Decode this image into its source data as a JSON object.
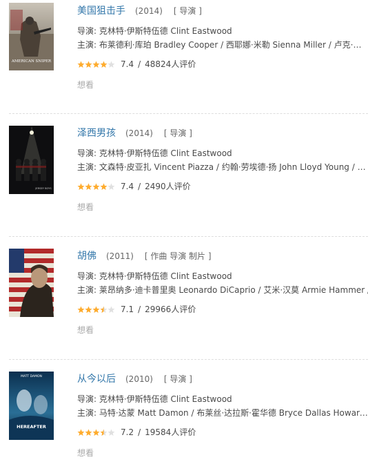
{
  "colors": {
    "title": "#3377aa",
    "star": "#ffac2d",
    "star_empty": "#e0e0e0",
    "divider": "#dddddd"
  },
  "movies": [
    {
      "title": "美国狙击手",
      "year": "(2014)",
      "roles": "[ 导演 ]",
      "director": "导演: 克林特·伊斯特伍德 Clint Eastwood",
      "cast": "主演: 布莱德利·库珀 Bradley Cooper / 西耶娜·米勒 Sienna Miller / 卢克·葛莱姆斯 Luke Grimes",
      "stars": 4,
      "score": "7.4",
      "sep": "/",
      "votes": "48824人评价",
      "wish": "想看",
      "poster_text": "AMERICAN SNIPER"
    },
    {
      "title": "泽西男孩",
      "year": "(2014)",
      "roles": "[ 导演 ]",
      "director": "导演: 克林特·伊斯特伍德 Clint Eastwood",
      "cast": "主演: 文森特·皮亚扎 Vincent Piazza / 约翰·劳埃德·扬 John Lloyd Young / 史蒂夫·施林",
      "stars": 4,
      "score": "7.4",
      "sep": "/",
      "votes": "2490人评价",
      "wish": "想看",
      "poster_text": "JERSEY BOYS"
    },
    {
      "title": "胡佛",
      "year": "(2011)",
      "roles": "[ 作曲 导演 制片 ]",
      "director": "导演: 克林特·伊斯特伍德 Clint Eastwood",
      "cast": "主演: 莱昂纳多·迪卡普里奥 Leonardo DiCaprio / 艾米·汉莫 Armie Hammer / 乔什·哈",
      "stars": 3.5,
      "score": "7.1",
      "sep": "/",
      "votes": "29966人评价",
      "wish": "想看",
      "poster_text": ""
    },
    {
      "title": "从今以后",
      "year": "(2010)",
      "roles": "[ 导演 ]",
      "director": "导演: 克林特·伊斯特伍德 Clint Eastwood",
      "cast": "主演: 马特·达蒙 Matt Damon / 布莱丝·达拉斯·霍华德 Bryce Dallas Howard / 西西·弗朗",
      "stars": 3.5,
      "score": "7.2",
      "sep": "/",
      "votes": "19584人评价",
      "wish": "想看",
      "poster_text": "HEREAFTER",
      "poster_top_text": "MATT DAMON"
    }
  ]
}
